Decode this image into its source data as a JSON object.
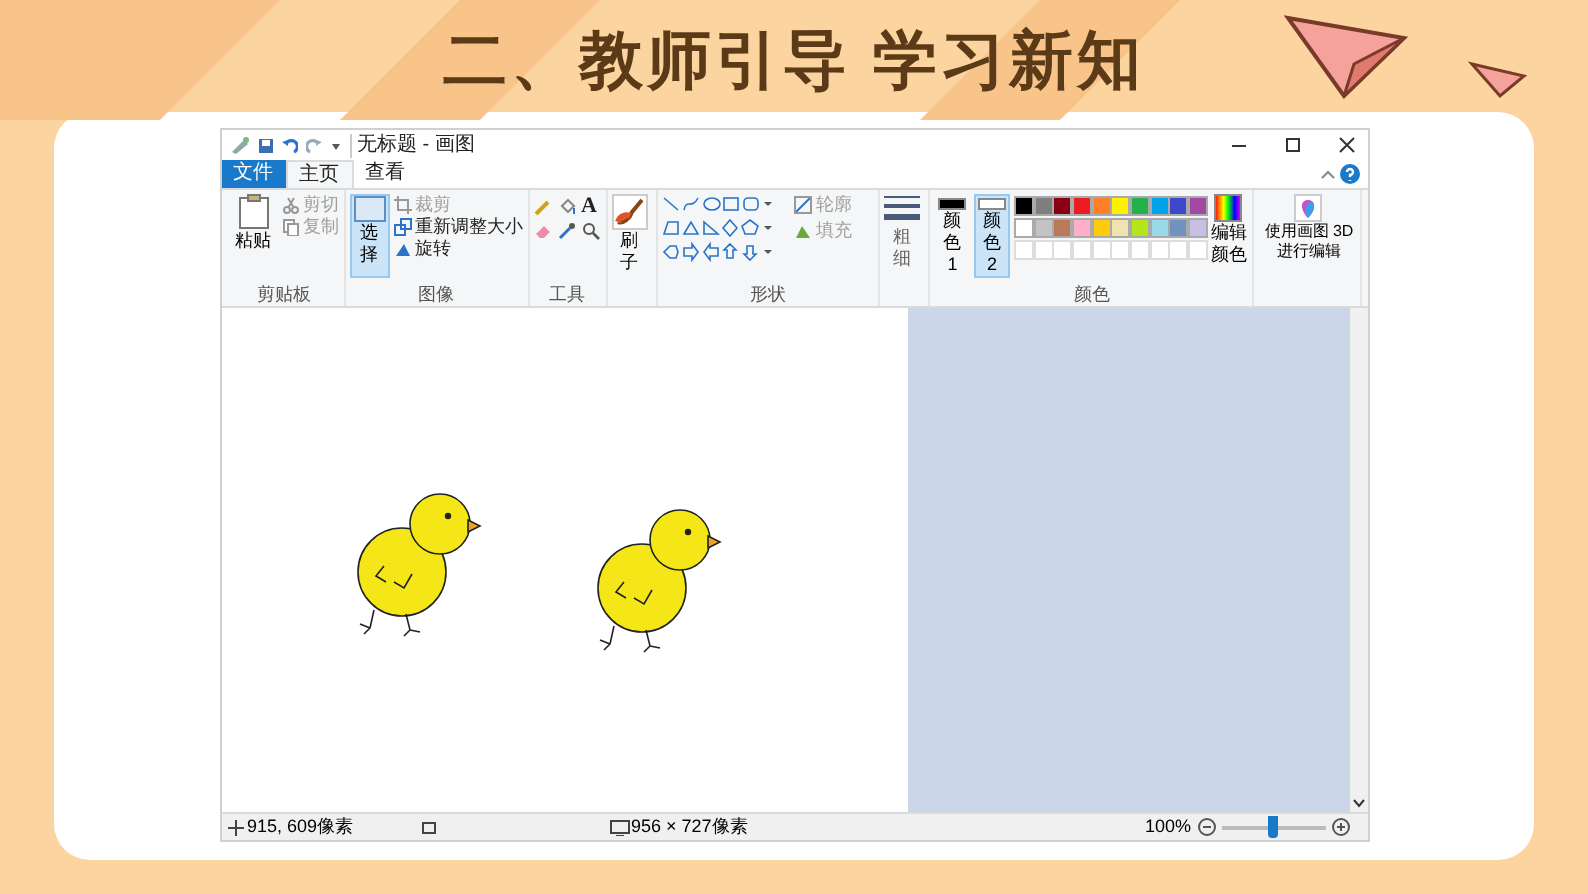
{
  "slide_title": "二、教师引导 学习新知",
  "window": {
    "title": "无标题 - 画图"
  },
  "menu_tabs": [
    {
      "label": "文件",
      "kind": "file",
      "selected": false
    },
    {
      "label": "主页",
      "kind": "tab",
      "selected": true
    },
    {
      "label": "查看",
      "kind": "tab",
      "selected": false
    }
  ],
  "clipboard": {
    "paste": "粘贴",
    "cut": {
      "label": "剪切",
      "disabled": true
    },
    "copy": {
      "label": "复制",
      "disabled": true
    },
    "group": "剪贴板"
  },
  "image": {
    "select": {
      "label": "选择",
      "selected": true
    },
    "crop": {
      "label": "裁剪",
      "disabled": true
    },
    "resize": "重新调整大小",
    "rotate": "旋转",
    "group": "图像"
  },
  "tools": {
    "group": "工具",
    "text_tool": "A"
  },
  "brushes": {
    "label": "刷子"
  },
  "shapes": {
    "outline": "轮廓",
    "fill": "填充",
    "group": "形状"
  },
  "size": {
    "label": "粗细"
  },
  "colors": {
    "color1": {
      "label": "颜色 1",
      "color": "#000000",
      "selected": false
    },
    "color2": {
      "label": "颜色 2",
      "color": "#ffffff",
      "selected": true
    },
    "palette": [
      {
        "color": "#000000"
      },
      {
        "color": "#7f7f7f"
      },
      {
        "color": "#880015"
      },
      {
        "color": "#ed1c24"
      },
      {
        "color": "#ff7f27"
      },
      {
        "color": "#fff200"
      },
      {
        "color": "#22b14c"
      },
      {
        "color": "#00a2e8"
      },
      {
        "color": "#3f48cc"
      },
      {
        "color": "#a349a4"
      },
      {
        "color": "#ffffff"
      },
      {
        "color": "#c3c3c3"
      },
      {
        "color": "#b97a57"
      },
      {
        "color": "#ffaec9"
      },
      {
        "color": "#ffc90e"
      },
      {
        "color": "#efe4b0"
      },
      {
        "color": "#b5e61d"
      },
      {
        "color": "#99d9ea"
      },
      {
        "color": "#7092be"
      },
      {
        "color": "#c8bfe7"
      }
    ],
    "edit_colors": "编辑颜色",
    "group": "颜色"
  },
  "paint3d": {
    "label": "使用画图 3D 进行编辑"
  },
  "status_bar": {
    "cursor": "915, 609像素",
    "canvas_size": "956 × 727像素",
    "zoom": "100%",
    "zoom_slider": {
      "level": 0.5
    }
  }
}
